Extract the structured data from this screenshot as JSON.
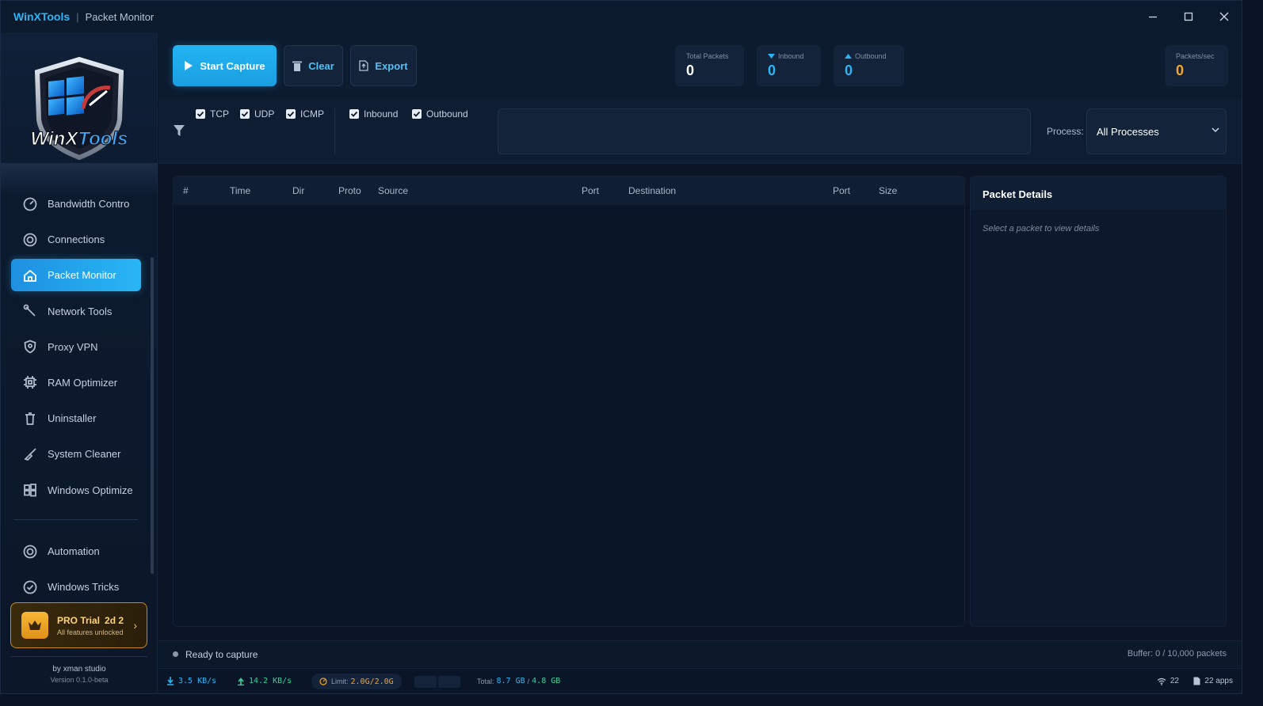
{
  "titlebar": {
    "app_name": "WinXTools",
    "separator": "|",
    "page_name": "Packet Monitor",
    "minimize_icon": "minimize-icon",
    "maximize_icon": "maximize-icon",
    "close_icon": "close-icon"
  },
  "sidebar": {
    "logo_text": "WinXTools",
    "items": [
      {
        "label": "Bandwidth Contro",
        "icon": "gauge-icon",
        "active": false
      },
      {
        "label": "Connections",
        "icon": "target-icon",
        "active": false
      },
      {
        "label": "Packet Monitor",
        "icon": "home-icon",
        "active": true
      },
      {
        "label": "Network Tools",
        "icon": "wrench-icon",
        "active": false
      },
      {
        "label": "Proxy VPN",
        "icon": "shield-icon",
        "active": false
      },
      {
        "label": "RAM Optimizer",
        "icon": "chip-icon",
        "active": false
      },
      {
        "label": "Uninstaller",
        "icon": "trash-icon",
        "active": false
      },
      {
        "label": "System Cleaner",
        "icon": "broom-icon",
        "active": false
      },
      {
        "label": "Windows Optimize",
        "icon": "windows-icon",
        "active": false
      }
    ],
    "items_bottom": [
      {
        "label": "Automation",
        "icon": "target-icon"
      },
      {
        "label": "Windows Tricks",
        "icon": "check-circle-icon"
      }
    ],
    "pro": {
      "title": "PRO Trial",
      "days": "2d 2",
      "subtitle": "All features unlocked"
    },
    "credit": "by xman studio",
    "version": "Version 0.1.0-beta"
  },
  "toolbar": {
    "start_label": "Start Capture",
    "clear_label": "Clear",
    "export_label": "Export"
  },
  "stats": {
    "total_label": "Total Packets",
    "total_value": "0",
    "inbound_label": "Inbound",
    "inbound_value": "0",
    "outbound_label": "Outbound",
    "outbound_value": "0",
    "pps_label": "Packets/sec",
    "pps_value": "0"
  },
  "filters": {
    "tcp": "TCP",
    "udp": "UDP",
    "icmp": "ICMP",
    "inbound": "Inbound",
    "outbound": "Outbound",
    "search_placeholder": "",
    "process_label": "Process:",
    "process_value": "All Processes"
  },
  "table": {
    "columns": [
      "#",
      "Time",
      "Dir",
      "Proto",
      "Source",
      "Port",
      "Destination",
      "Port",
      "Size"
    ],
    "rows": []
  },
  "details": {
    "title": "Packet Details",
    "empty": "Select a packet to view details"
  },
  "status": {
    "text": "Ready to capture",
    "buffer": "Buffer: 0 / 10,000 packets"
  },
  "bottom": {
    "down": "3.5 KB/s",
    "up": "14.2 KB/s",
    "limit_label": "Limit:",
    "limit_value": "2.0G/2.0G",
    "total_label": "Total:",
    "total_down": "8.7 GB",
    "total_sep": "/",
    "total_up": "4.8 GB",
    "wifi_count": "22",
    "apps": "22 apps"
  },
  "colors": {
    "accent": "#29b6f6",
    "warning": "#f5a623",
    "success": "#36d399",
    "background": "#0b1526"
  }
}
